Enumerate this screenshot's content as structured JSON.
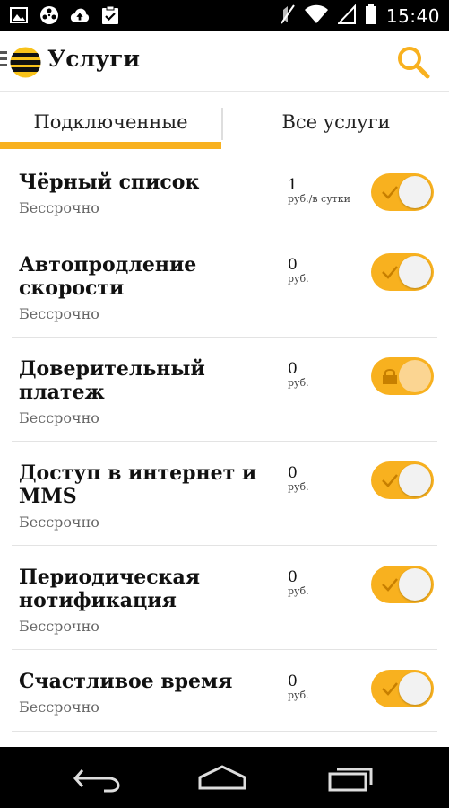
{
  "status_bar": {
    "time": "15:40",
    "icons": [
      "gallery-icon",
      "media-icon",
      "cloud-upload-icon",
      "clipboard-check-icon",
      "mute-icon",
      "wifi-icon",
      "signal-icon",
      "battery-icon"
    ]
  },
  "app_bar": {
    "title": "Услуги",
    "icons": [
      "menu-icon",
      "beeline-logo-icon",
      "search-icon"
    ]
  },
  "tabs": [
    {
      "label": "Подключенные",
      "active": true
    },
    {
      "label": "Все услуги",
      "active": false
    }
  ],
  "services": [
    {
      "name": "Чёрный список",
      "sub": "Бессрочно",
      "price": "1",
      "unit": "руб./в сутки",
      "on": true,
      "locked": false
    },
    {
      "name": "Автопродление скорости",
      "sub": "Бессрочно",
      "price": "0",
      "unit": "руб.",
      "on": true,
      "locked": false
    },
    {
      "name": "Доверительный платеж",
      "sub": "Бессрочно",
      "price": "0",
      "unit": "руб.",
      "on": true,
      "locked": true
    },
    {
      "name": "Доступ в интернет и MMS",
      "sub": "Бессрочно",
      "price": "0",
      "unit": "руб.",
      "on": true,
      "locked": false
    },
    {
      "name": "Периодическая нотификация",
      "sub": "Бессрочно",
      "price": "0",
      "unit": "руб.",
      "on": true,
      "locked": false
    },
    {
      "name": "Счастливое время",
      "sub": "Бессрочно",
      "price": "0",
      "unit": "руб.",
      "on": true,
      "locked": false
    }
  ],
  "nav_bar": {
    "icons": [
      "back-icon",
      "home-icon",
      "recents-icon"
    ]
  },
  "colors": {
    "accent": "#f8b11f",
    "status_bar": "#000000",
    "text": "#111111",
    "subtext": "#666666"
  }
}
